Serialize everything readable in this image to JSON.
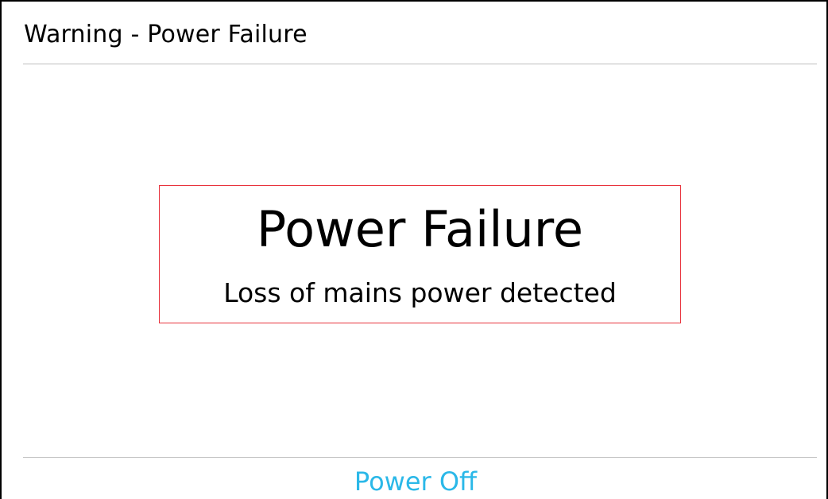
{
  "header": {
    "title": "Warning - Power Failure"
  },
  "alert": {
    "heading": "Power Failure",
    "message": "Loss of mains power detected",
    "border_color": "#e8323c"
  },
  "footer": {
    "power_off_label": "Power Off",
    "accent_color": "#2bb8e8"
  }
}
